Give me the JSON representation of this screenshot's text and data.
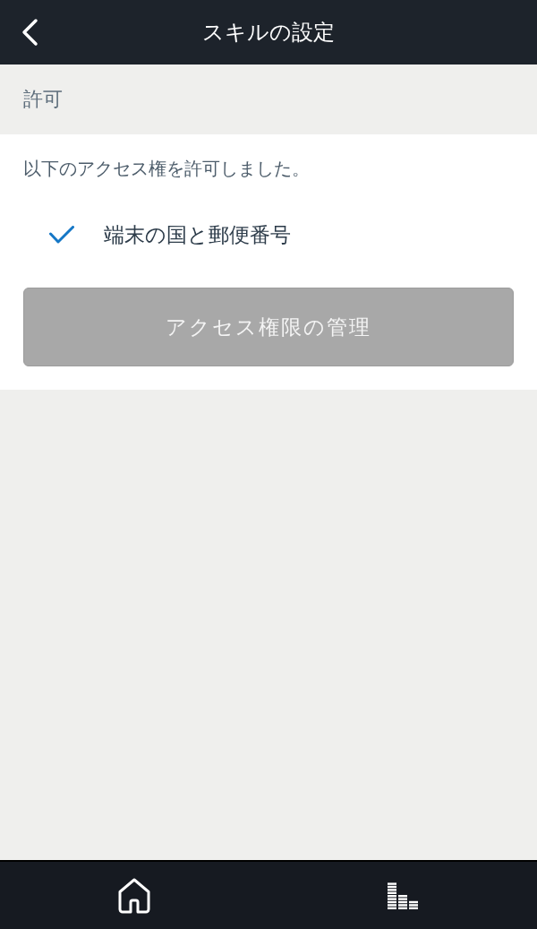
{
  "header": {
    "title": "スキルの設定"
  },
  "section": {
    "heading": "許可"
  },
  "permissions": {
    "intro": "以下のアクセス権を許可しました。",
    "items": [
      {
        "label": "端末の国と郵便番号",
        "checked": true
      }
    ],
    "button": {
      "label": "アクセス権限の管理",
      "disabled": true
    }
  },
  "bottom_nav": [
    {
      "kind": "home"
    },
    {
      "kind": "activity"
    }
  ]
}
